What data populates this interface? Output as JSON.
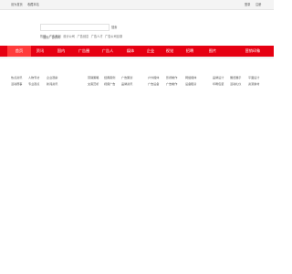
{
  "topbar": {
    "left_links": [
      "设为首页",
      "收藏本站"
    ],
    "right_links": [
      "登录",
      "注册"
    ]
  },
  "search": {
    "placeholder": "搜索广告资讯",
    "button": "搜索",
    "hot_label": "热搜:",
    "hot_words": [
      "广告策划",
      "设计公司",
      "广告创意",
      "广告人才",
      "广告公司目录"
    ]
  },
  "nav": {
    "items": [
      "首页",
      "资讯",
      "国内",
      "广告圈",
      "广告人",
      "媒体",
      "企业",
      "视觉",
      "招聘",
      "图片",
      "营销印象"
    ]
  },
  "links": {
    "col1": [
      "热点资讯",
      "活动赛事"
    ],
    "col2": [
      "人物专访",
      "专业观点"
    ],
    "col3": [
      "企业观察",
      "新闻资讯"
    ],
    "col4": [
      "营销策略",
      "文案赏析"
    ],
    "col5": [
      "经典案例",
      "视频广告"
    ],
    "col6": [
      "广告策划",
      "品牌资讯"
    ],
    "col7": [
      "户外媒体",
      "广告设备"
    ],
    "col8": [
      "影视制作",
      "广告制作"
    ],
    "col9": [
      "网络媒体",
      "设备租赁"
    ],
    "col10": [
      "品牌设计",
      "印刷包装"
    ],
    "col11": [
      "展览展示",
      "活动礼仪"
    ],
    "col12": [
      "平面设计",
      "资源素材"
    ]
  }
}
